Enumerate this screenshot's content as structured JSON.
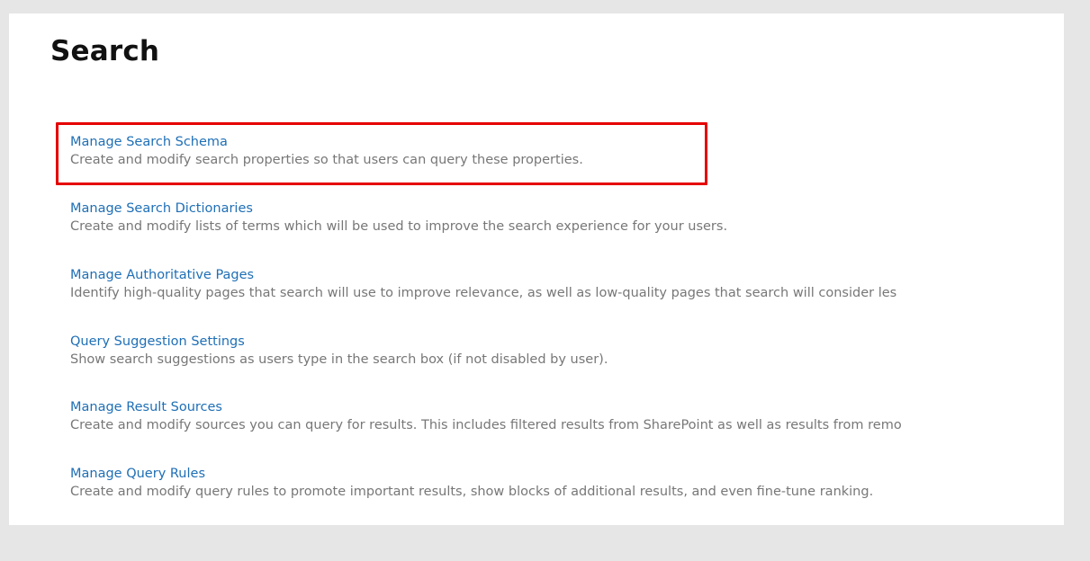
{
  "page": {
    "title": "Search"
  },
  "colors": {
    "link": "#1e6fb6",
    "description": "#777777",
    "highlight": "#e60000",
    "background": "#e6e6e6",
    "panel": "#ffffff"
  },
  "items": [
    {
      "label": "Manage Search Schema",
      "description": "Create and modify search properties so that users can query these properties."
    },
    {
      "label": "Manage Search Dictionaries",
      "description": "Create and modify lists of terms which will be used to improve the search experience for your users."
    },
    {
      "label": "Manage Authoritative Pages",
      "description": "Identify high-quality pages that search will use to improve relevance, as well as low-quality pages that search will consider les"
    },
    {
      "label": "Query Suggestion Settings",
      "description": "Show search suggestions as users type in the search box (if not disabled by user)."
    },
    {
      "label": "Manage Result Sources",
      "description": "Create and modify sources you can query for results. This includes filtered results from SharePoint as well as results from remo"
    },
    {
      "label": "Manage Query Rules",
      "description": "Create and modify query rules to promote important results, show blocks of additional results, and even fine-tune ranking."
    }
  ]
}
